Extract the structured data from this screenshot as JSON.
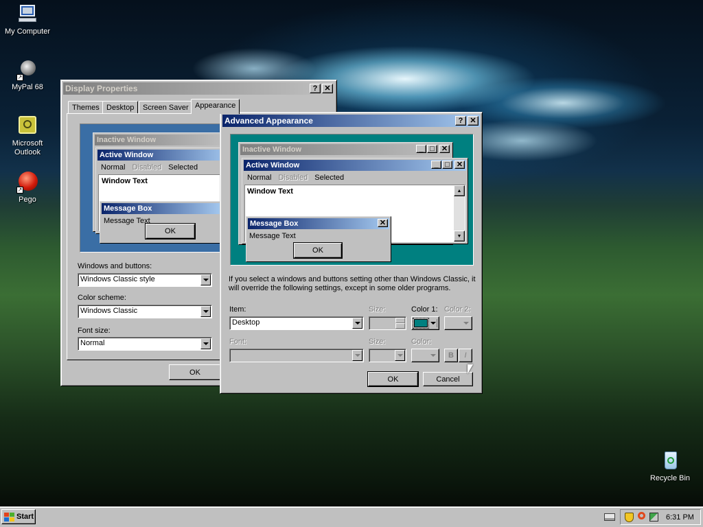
{
  "desktop": {
    "icons": [
      {
        "label": "My Computer",
        "icon": "my-computer-icon"
      },
      {
        "label": "MyPal 68",
        "icon": "mypal-icon"
      },
      {
        "label": "Microsoft\nOutlook",
        "icon": "outlook-icon"
      },
      {
        "label": "Pego",
        "icon": "pego-icon"
      },
      {
        "label": "Recycle Bin",
        "icon": "recycle-bin-icon"
      }
    ]
  },
  "display_properties": {
    "title": "Display Properties",
    "help_btn": "?",
    "close_btn": "✕",
    "tabs": [
      "Themes",
      "Desktop",
      "Screen Saver",
      "Appearance"
    ],
    "preview": {
      "inactive_title": "Inactive Window",
      "active_title": "Active Window",
      "menu_normal": "Normal",
      "menu_disabled": "Disabled",
      "menu_selected": "Selected",
      "window_text": "Window Text",
      "message_box_title": "Message Box",
      "message_text": "Message Text",
      "ok": "OK"
    },
    "windows_buttons_label": "Windows and buttons:",
    "windows_buttons_value": "Windows Classic style",
    "color_scheme_label": "Color scheme:",
    "color_scheme_value": "Windows Classic",
    "font_size_label": "Font size:",
    "font_size_value": "Normal",
    "ok": "OK"
  },
  "advanced": {
    "title": "Advanced Appearance",
    "help_btn": "?",
    "close_btn": "✕",
    "preview": {
      "inactive_title": "Inactive Window",
      "active_title": "Active Window",
      "menu_normal": "Normal",
      "menu_disabled": "Disabled",
      "menu_selected": "Selected",
      "window_text": "Window Text",
      "message_box_title": "Message Box",
      "message_text": "Message Text",
      "ok": "OK"
    },
    "description": "If you select a windows and buttons setting other than Windows Classic, it will override the following settings, except in some older programs.",
    "item_label": "Item:",
    "item_value": "Desktop",
    "size_label": "Size:",
    "color1_label": "Color 1:",
    "color2_label": "Color 2:",
    "font_label": "Font:",
    "font_size_label": "Size:",
    "font_color_label": "Color:",
    "bold_btn": "B",
    "italic_btn": "I",
    "ok": "OK",
    "cancel": "Cancel",
    "desktop_color": "#008080"
  },
  "taskbar": {
    "start": "Start",
    "clock": "6:31 PM"
  }
}
